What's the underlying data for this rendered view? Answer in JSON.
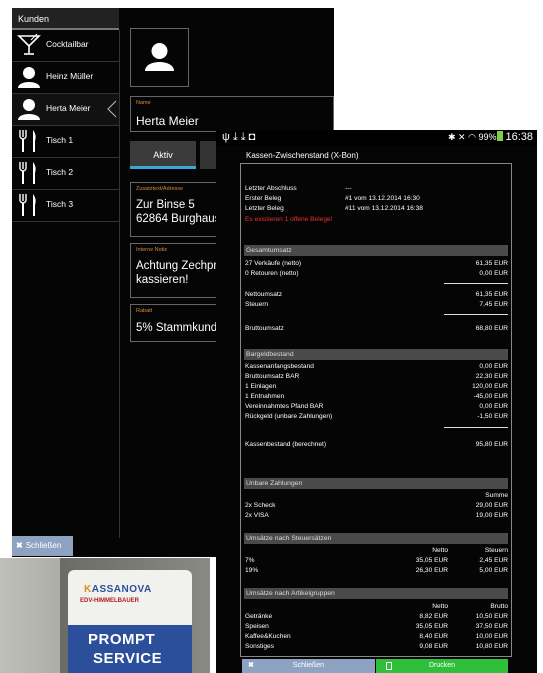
{
  "customers_app": {
    "header_title": "Kunden",
    "items": [
      {
        "label": "Cocktailbar",
        "icon": "cocktail-glass-icon",
        "selected": false
      },
      {
        "label": "Heinz Müller",
        "icon": "person-icon",
        "selected": false
      },
      {
        "label": "Herta Meier",
        "icon": "person-icon",
        "selected": true
      },
      {
        "label": "Tisch 1",
        "icon": "fork-knife-icon",
        "selected": false
      },
      {
        "label": "Tisch 2",
        "icon": "fork-knife-icon",
        "selected": false
      },
      {
        "label": "Tisch 3",
        "icon": "fork-knife-icon",
        "selected": false
      }
    ],
    "detail": {
      "name_label": "Name",
      "name_value": "Herta Meier",
      "tab_active": "Aktiv",
      "address_label": "Zusatztext/Adresse",
      "address_line1": "Zur Binse 5",
      "address_line2": "62864 Burghaus",
      "note_label": "Interne Notiz",
      "note_line1": "Achtung Zechpr",
      "note_line2": "kassieren!",
      "discount_label": "Rabatt",
      "discount_value": "5% Stammkund"
    },
    "close_button": "Schließen"
  },
  "xbon_app": {
    "status": {
      "battery": "99%",
      "time": "16:38"
    },
    "title": "Kassen-Zwischenstand (X-Bon)",
    "intro": [
      {
        "label": "Letzter Abschluss",
        "value": "---"
      },
      {
        "label": "Erster Beleg",
        "value": "#1 vom 13.12.2014 16:30"
      },
      {
        "label": "Letzter Beleg",
        "value": "#11 vom 13.12.2014 16:38"
      }
    ],
    "warning": "Es existieren 1 offene Belege!",
    "section_gesamtumsatz": "Gesamtumsatz",
    "verkaeufe_label": "27 Verkäufe (netto)",
    "verkaeufe_value": "61,35 EUR",
    "retouren_label": "0 Retouren (netto)",
    "retouren_value": "0,00 EUR",
    "nettoumsatz_label": "Nettoumsatz",
    "nettoumsatz_value": "61,35 EUR",
    "steuern_label": "Steuern",
    "steuern_value": "7,45 EUR",
    "bruttoumsatz_label": "Bruttoumsatz",
    "bruttoumsatz_value": "68,80 EUR",
    "section_bargeld": "Bargeldbestand",
    "bargeld_rows": [
      {
        "label": "Kassenanfangsbestand",
        "value": "0,00 EUR"
      },
      {
        "label": "Bruttoumsatz BAR",
        "value": "22,30 EUR"
      },
      {
        "label": "1 Einlagen",
        "value": "120,00 EUR"
      },
      {
        "label": "1 Entnahmen",
        "value": "-45,00 EUR"
      },
      {
        "label": "Vereinnahmtes Pfand BAR",
        "value": "0,00 EUR"
      },
      {
        "label": "Rückgeld (unbare Zahlungen)",
        "value": "-1,50 EUR"
      }
    ],
    "kassenbestand_label": "Kassenbestand (berechnet)",
    "kassenbestand_value": "95,80 EUR",
    "section_unbar": "Unbare Zahlungen",
    "unbar_header": "Summe",
    "unbar_rows": [
      {
        "label": "2x Scheck",
        "value": "29,00 EUR"
      },
      {
        "label": "2x VISA",
        "value": "19,00 EUR"
      }
    ],
    "section_steuer": "Umsätze nach Steuersätzen",
    "steuer_col_netto": "Netto",
    "steuer_col_steuern": "Steuern",
    "steuer_rows": [
      {
        "label": "7%",
        "netto": "35,05 EUR",
        "steuer": "2,45 EUR"
      },
      {
        "label": "19%",
        "netto": "26,30 EUR",
        "steuer": "5,00 EUR"
      }
    ],
    "section_artikel": "Umsätze nach Artikelgruppen",
    "artikel_col_netto": "Netto",
    "artikel_col_brutto": "Brutto",
    "artikel_rows": [
      {
        "label": "Getränke",
        "netto": "8,82 EUR",
        "brutto": "10,50 EUR"
      },
      {
        "label": "Speisen",
        "netto": "35,05 EUR",
        "brutto": "37,50 EUR"
      },
      {
        "label": "Kaffee&Kuchen",
        "netto": "8,40 EUR",
        "brutto": "10,00 EUR"
      },
      {
        "label": "Sonstiges",
        "netto": "9,08 EUR",
        "brutto": "10,80 EUR"
      }
    ],
    "close_button": "Schließen",
    "print_button": "Drucken"
  },
  "photo": {
    "logo_k": "K",
    "logo_rest": "ASSANOVA",
    "subline": "EDV-HIMMELBAUER",
    "line1": "PROMPT",
    "line2": "SERVICE"
  },
  "colors": {
    "accent_blue": "#3aa7d6",
    "warning_red": "#f03030",
    "print_green": "#2fbf3a",
    "close_gray_blue": "#8ea3c2",
    "label_orange": "#d68b3a"
  }
}
